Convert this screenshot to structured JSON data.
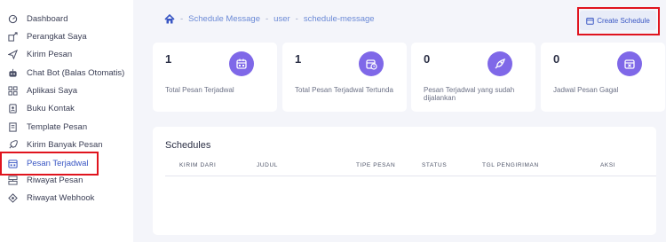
{
  "sidebar": {
    "items": [
      {
        "label": "Dashboard",
        "icon": "dashboard-icon"
      },
      {
        "label": "Perangkat Saya",
        "icon": "device-icon"
      },
      {
        "label": "Kirim Pesan",
        "icon": "send-icon"
      },
      {
        "label": "Chat Bot (Balas Otomatis)",
        "icon": "bot-icon"
      },
      {
        "label": "Aplikasi Saya",
        "icon": "apps-icon"
      },
      {
        "label": "Buku Kontak",
        "icon": "contact-book-icon"
      },
      {
        "label": "Template Pesan",
        "icon": "template-icon"
      },
      {
        "label": "Kirim Banyak Pesan",
        "icon": "bulk-send-icon"
      },
      {
        "label": "Pesan Terjadwal",
        "icon": "calendar-icon",
        "active": true
      },
      {
        "label": "Riwayat Pesan",
        "icon": "history-icon"
      },
      {
        "label": "Riwayat Webhook",
        "icon": "webhook-icon"
      }
    ]
  },
  "breadcrumb": {
    "home_icon": "home-icon",
    "items": [
      "Schedule Message",
      "user",
      "schedule-message"
    ]
  },
  "header": {
    "create_label": "Create Schedule"
  },
  "stats": [
    {
      "value": "1",
      "label": "Total Pesan Terjadwal",
      "icon": "calendar-grid-icon"
    },
    {
      "value": "1",
      "label": "Total Pesan Terjadwal Tertunda",
      "icon": "calendar-clock-icon"
    },
    {
      "value": "0",
      "label": "Pesan Terjadwal yang sudah dijalankan",
      "icon": "rocket-icon"
    },
    {
      "value": "0",
      "label": "Jadwal Pesan Gagal",
      "icon": "calendar-x-icon"
    }
  ],
  "schedules": {
    "title": "Schedules",
    "columns": [
      "KIRIM DARI",
      "JUDUL",
      "TIPE PESAN",
      "STATUS",
      "TGL PENGIRIMAN",
      "AKSI"
    ],
    "rows": []
  },
  "colors": {
    "accent": "#7f68e8",
    "link": "#3a57c4",
    "highlight": "#e0141e"
  }
}
